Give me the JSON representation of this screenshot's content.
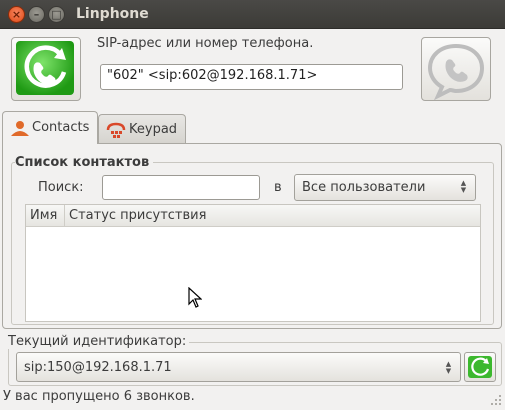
{
  "window": {
    "title": "Linphone",
    "close_glyph": "×",
    "minimize_glyph": "–",
    "maximize_glyph": "□"
  },
  "sip": {
    "label": "SIP-адрес или номер телефона.",
    "value": "\"602\" <sip:602@192.168.1.71>"
  },
  "tabs": [
    {
      "label": "Contacts",
      "icon": "contact-person-icon",
      "active": true
    },
    {
      "label": "Keypad",
      "icon": "keypad-phone-icon",
      "active": false
    }
  ],
  "contacts": {
    "frame_title": "Список контактов",
    "search_label": "Поиск:",
    "search_value": "",
    "in_label": "в",
    "filter_value": "Все пользователи",
    "columns": [
      "Имя",
      "Статус присутствия"
    ],
    "rows": []
  },
  "identity": {
    "label": "Текущий идентификатор:",
    "value": "sip:150@192.168.1.71"
  },
  "status": {
    "text": "У вас пропущено 6 звонков."
  },
  "colors": {
    "call_green": "#37b82c",
    "hangup_gray": "#b8b8b8",
    "close_orange": "#e8562a"
  }
}
